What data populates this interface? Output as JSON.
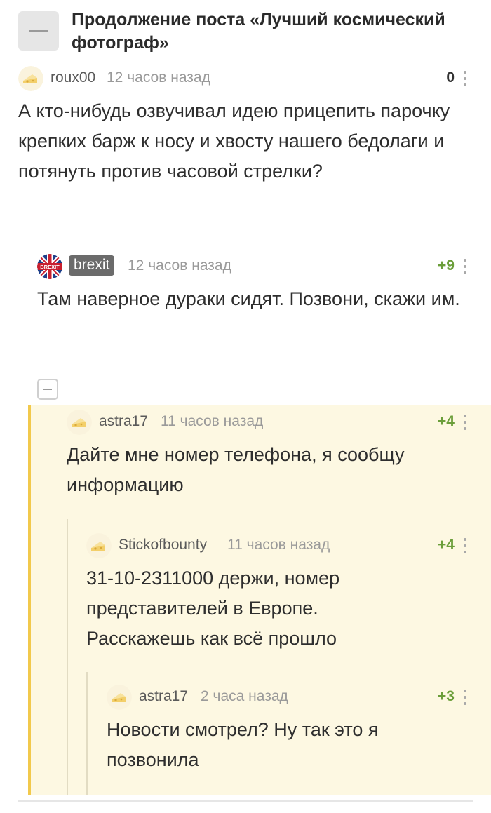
{
  "post": {
    "title": "Продолжение поста «Лучший космический фотограф»"
  },
  "comments": [
    {
      "username": "roux00",
      "time": "12 часов назад",
      "score": "0",
      "text": "А кто-нибудь озвучивал идею прицепить парочку крепких барж к носу и хвосту нашего бедолаги и потянуть против часовой стрелки?"
    },
    {
      "username": "brexit",
      "avatar_text": "BREXIT",
      "time": "12 часов назад",
      "score": "+9",
      "text": "Там наверное дураки сидят. Позвони, скажи им."
    },
    {
      "username": "astra17",
      "time": "11 часов назад",
      "score": "+4",
      "text": "Дайте мне номер телефона, я сообщу информацию"
    },
    {
      "username": "Stickofbounty",
      "time": "11 часов назад",
      "score": "+4",
      "text": "31-10-2311000 держи, номер представителей в Европе. Расскажешь как всё прошло"
    },
    {
      "username": "astra17",
      "time": "2 часа назад",
      "score": "+3",
      "text": "Новости смотрел? Ну так это я позвонила"
    }
  ],
  "colors": {
    "score_positive": "#6b9e3a",
    "thread_highlight_bg": "#fdf8e2",
    "thread_highlight_bar": "#f2c94c"
  }
}
